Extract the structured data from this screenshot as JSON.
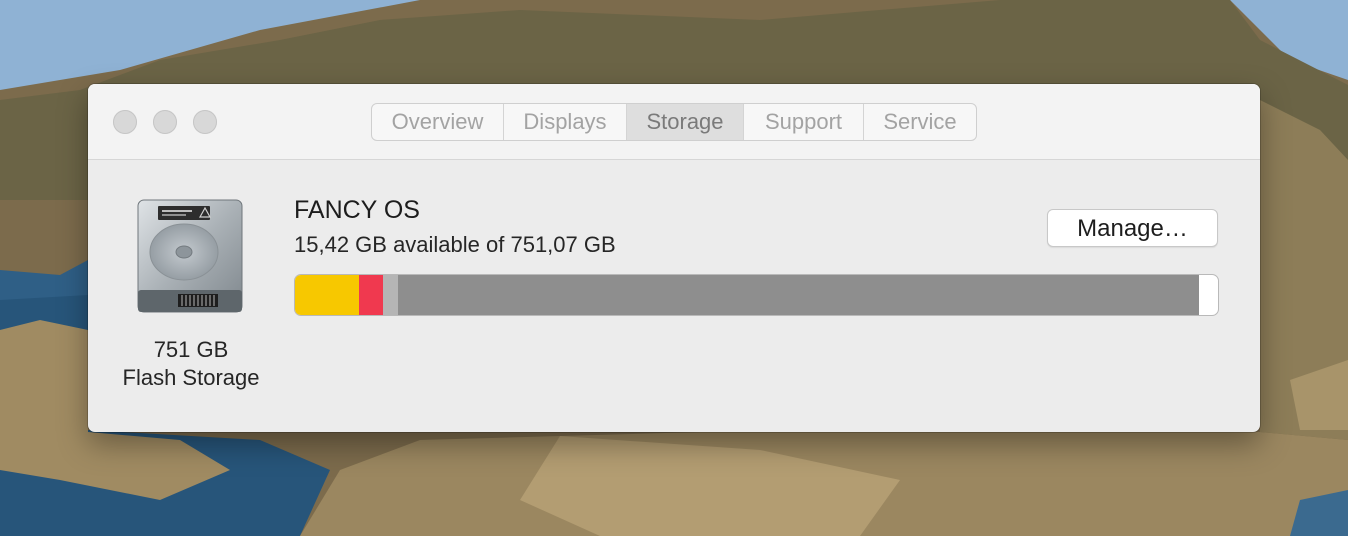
{
  "window": {
    "tabs": [
      {
        "label": "Overview",
        "selected": false
      },
      {
        "label": "Displays",
        "selected": false
      },
      {
        "label": "Storage",
        "selected": true
      },
      {
        "label": "Support",
        "selected": false
      },
      {
        "label": "Service",
        "selected": false
      }
    ]
  },
  "disk": {
    "icon": "hard-drive-icon",
    "size_label": "751 GB",
    "type_label": "Flash Storage"
  },
  "volume": {
    "name": "FANCY OS",
    "available_text": "15,42 GB available of 751,07 GB",
    "manage_label": "Manage…"
  },
  "storage_usage": {
    "capacity_gb": 751.07,
    "available_gb": 15.42,
    "segments": [
      {
        "name": "yellow-category",
        "fraction": 0.069,
        "color": "#f7c800"
      },
      {
        "name": "red-category",
        "fraction": 0.026,
        "color": "#f0394f"
      },
      {
        "name": "light-gray-category",
        "fraction": 0.017,
        "color": "#b5b5b5"
      },
      {
        "name": "gray-category",
        "fraction": 0.868,
        "color": "#8e8e8e"
      }
    ]
  },
  "colors": {
    "window_bg": "#ececec",
    "titlebar_bg": "#f3f3f3",
    "selected_tab_bg": "#dedede"
  }
}
